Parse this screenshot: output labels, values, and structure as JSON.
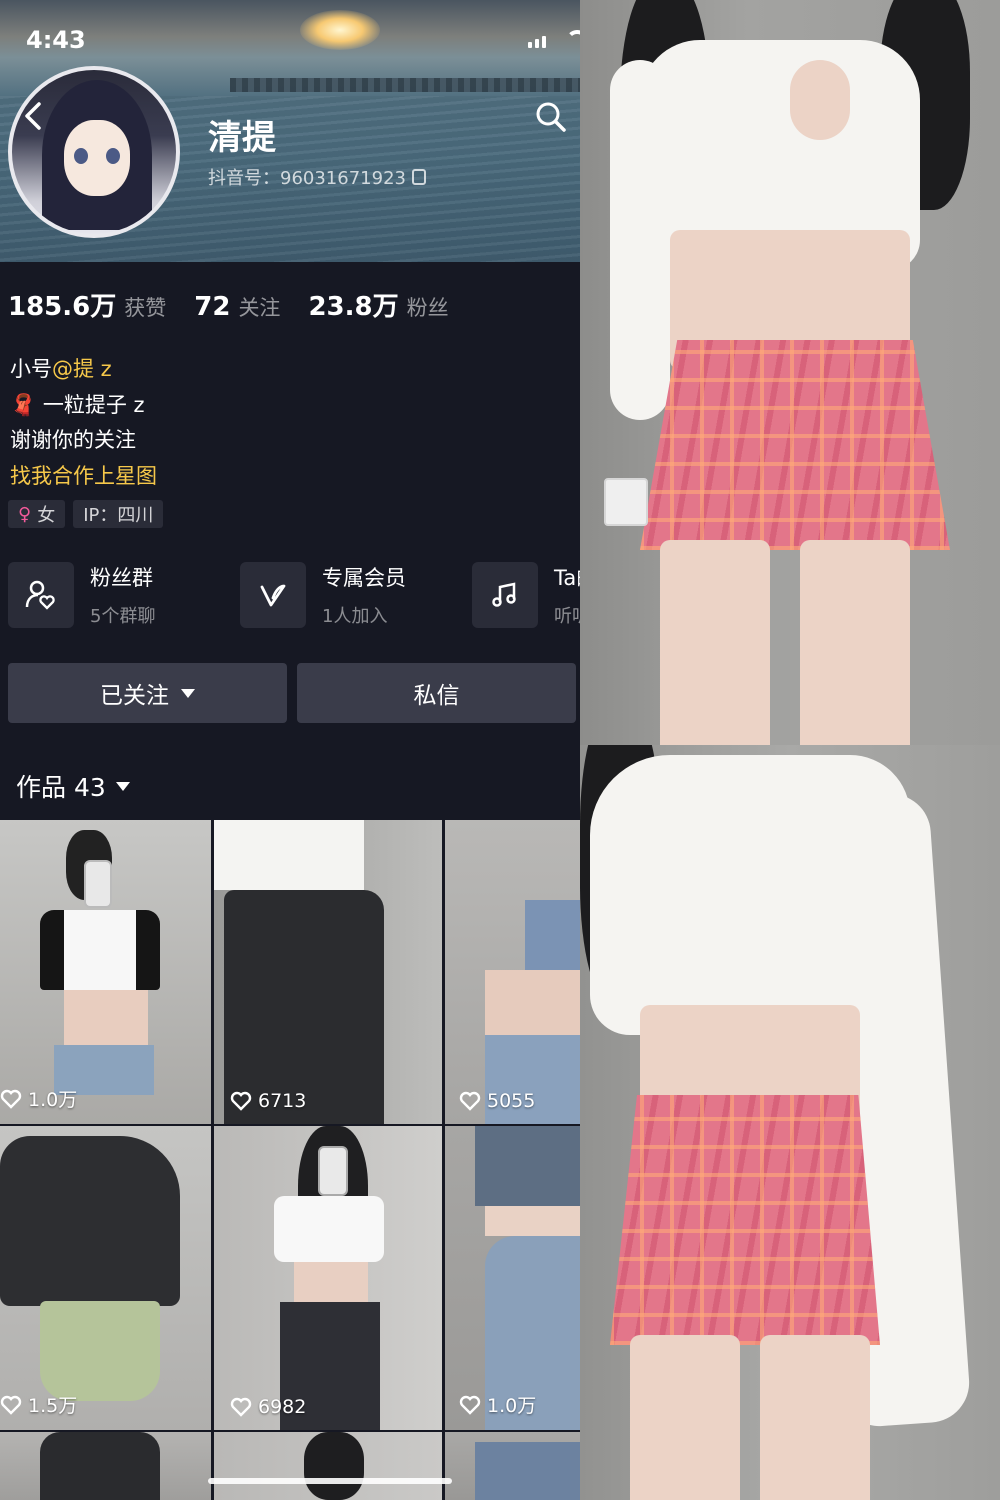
{
  "status_bar": {
    "time": "4:43",
    "location_arrow": "location-arrow-icon"
  },
  "profile": {
    "nickname": "清提",
    "douyin_id": "抖音号：96031671923",
    "stats": [
      {
        "num": "185.6万",
        "label": "获赞"
      },
      {
        "num": "72",
        "label": "关注"
      },
      {
        "num": "23.8万",
        "label": "粉丝"
      }
    ],
    "bio": {
      "line1_prefix": "小号",
      "line1_mention": "@提 z",
      "line2_emoji": "🧣",
      "line2_text": "一粒提子 z",
      "line3": "谢谢你的关注",
      "line4_link": "找我合作上星图"
    },
    "tags": {
      "gender": "女",
      "gender_icon": "♀",
      "ip": "IP：四川"
    }
  },
  "features": [
    {
      "title": "粉丝群",
      "subtitle": "5个群聊",
      "icon": "fans-group-icon"
    },
    {
      "title": "专属会员",
      "subtitle": "1人加入",
      "icon": "member-icon"
    },
    {
      "title": "Ta的",
      "subtitle": "听听",
      "icon": "music-icon"
    }
  ],
  "actions": {
    "follow": "已关注",
    "message": "私信"
  },
  "works": {
    "label": "作品 43",
    "items": [
      {
        "likes": "1.0万"
      },
      {
        "likes": "6713"
      },
      {
        "likes": "5055"
      },
      {
        "likes": "1.5万"
      },
      {
        "likes": "6982"
      },
      {
        "likes": "1.0万"
      }
    ]
  },
  "colors": {
    "background": "#161823",
    "accent_yellow": "#f6c84a",
    "button": "#3a3c4a"
  }
}
